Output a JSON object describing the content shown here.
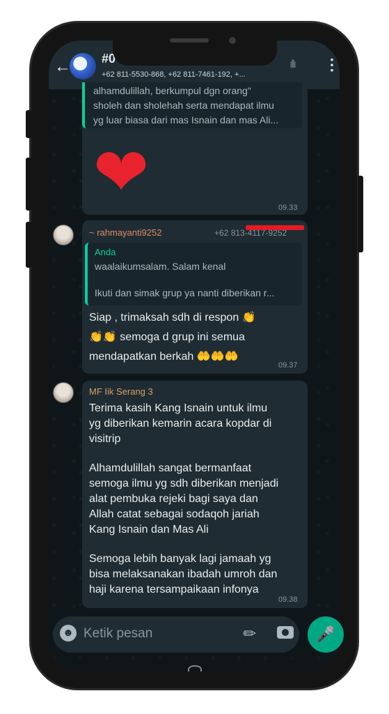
{
  "header": {
    "title": "#0",
    "subtitle": "+62 811-5530-868, +62 811-7461-192, +..."
  },
  "messages": [
    {
      "quote_lines": [
        "alhamdulillah, berkumpul dgn orang\"",
        "sholeh dan sholehah serta mendapat ilmu",
        "yg luar biasa dari mas Isnain dan mas Ali..."
      ],
      "emoji": "❤",
      "time": "09.33"
    },
    {
      "sender": "~ rahmayanti9252",
      "phone": "+62 813-4117-9252",
      "quote_author": "Anda",
      "quote_line1": "waalaikumsalam. Salam kenal",
      "quote_line2": "Ikuti dan simak grup ya nanti diberikan r...",
      "lines": [
        "Siap  , trimaksah sdh di respon 👏",
        "👏👏 semoga d grup ini semua",
        "mendapatkan berkah 🤲🤲🤲"
      ],
      "time": "09.37"
    },
    {
      "sender": "MF Iik Serang 3",
      "lines": [
        "Terima kasih Kang Isnain untuk ilmu",
        "yg diberikan kemarin acara kopdar di",
        "visitrip",
        "",
        "Alhamdulillah sangat bermanfaat",
        "semoga ilmu yg sdh diberikan menjadi",
        "alat pembuka rejeki bagi saya dan",
        "Allah catat sebagai sodaqoh jariah",
        "Kang Isnain dan Mas Ali",
        "",
        "Semoga lebih banyak lagi jamaah yg",
        "bisa melaksanakan ibadah umroh dan",
        "haji karena tersampaikaan infonya"
      ],
      "time": "09.38"
    }
  ],
  "input": {
    "placeholder": "Ketik pesan"
  },
  "colors": {
    "accent": "#00a884",
    "quote_bar": "#06cf9c",
    "sender2": "#e08a6a",
    "sender3": "#d9a06a",
    "redact": "#e51b23"
  }
}
